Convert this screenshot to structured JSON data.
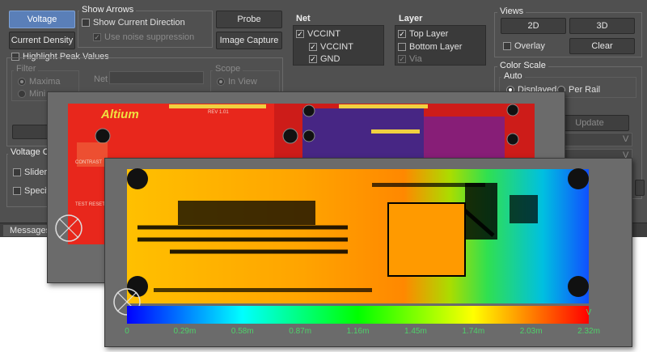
{
  "buttons": {
    "voltage": "Voltage",
    "current_density": "Current Density",
    "probe": "Probe",
    "image_capture": "Image Capture",
    "view_2d": "2D",
    "view_3d": "3D",
    "clear": "Clear",
    "update": "Update"
  },
  "show_arrows": {
    "title": "Show Arrows",
    "show_current_direction": "Show Current Direction",
    "use_noise_suppression": "Use noise suppression"
  },
  "highlight": {
    "label": "Highlight Peak Values",
    "filter_title": "Filter",
    "maxima": "Maxima",
    "minima_partial": "Mini",
    "net_label": "Net",
    "scope_title": "Scope",
    "in_view": "In View"
  },
  "voltage_contours": {
    "title_partial": "Voltage Co",
    "slider_partial": "Slider",
    "specific_partial": "Specifi"
  },
  "net": {
    "title": "Net",
    "items": [
      "VCCINT",
      "VCCINT",
      "GND"
    ]
  },
  "layer": {
    "title": "Layer",
    "items": [
      "Top Layer",
      "Bottom Layer",
      "Via"
    ]
  },
  "views": {
    "title": "Views",
    "overlay": "Overlay"
  },
  "color_scale": {
    "title": "Color Scale",
    "auto": "Auto",
    "displayed": "Displayed",
    "per_rail": "Per Rail",
    "v_partial_1": "V",
    "v_partial_2": "V"
  },
  "messages_tab": "Messages",
  "board": {
    "logo": "Altium",
    "labels": [
      "CONTRAST",
      "TEST RESET",
      "REV 1.01"
    ]
  },
  "scale_bar": {
    "unit": "V",
    "ticks": [
      "0",
      "0.29m",
      "0.58m",
      "0.87m",
      "1.16m",
      "1.45m",
      "1.74m",
      "2.03m",
      "2.32m"
    ]
  },
  "colors": {
    "panel_bg": "#505050",
    "accent": "#5a7fb8",
    "board_red": "#e8271c",
    "tick_green": "#4fd06a"
  }
}
